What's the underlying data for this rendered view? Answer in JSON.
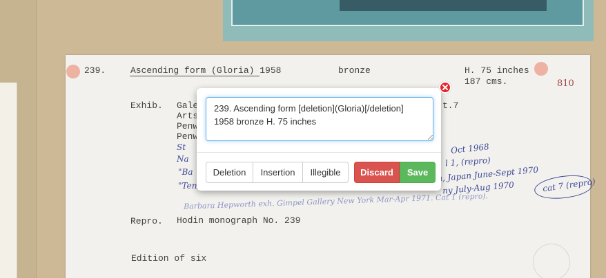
{
  "card": {
    "number": "239.",
    "title": "Ascending form (Gloria) 1958",
    "material": "bronze",
    "height_in": "H. 75 inches",
    "height_cm": "187 cms.",
    "catalogue_number": "810",
    "exhib_label": "Exhib.",
    "exhib_lines": [
      "Gale",
      "Arts",
      "Penw",
      "Penw"
    ],
    "exhib_fragment": "t.7",
    "handwritten": [
      "St",
      "Na",
      "\"Ba",
      "\"Ten",
      "Oct 1968",
      "l 1, (repro)",
      "n, Japan June-Sept 1970",
      "ny July-Aug 1970",
      "cat 7 (repro)",
      "Barbara Hepworth exh. Gimpel Gallery New York Mar-Apr 1971. Cat 1 (repro)."
    ],
    "repro_label": "Repro.",
    "repro_value": "Hodin monograph No. 239",
    "edition": "Edition of six"
  },
  "editor": {
    "text": "239. Ascending form [deletion](Gloria)[/deletion] 1958 bronze H. 75 inches",
    "buttons": {
      "deletion": "Deletion",
      "insertion": "Insertion",
      "illegible": "Illegible",
      "discard": "Discard",
      "save": "Save"
    }
  },
  "colors": {
    "discard": "#d9534f",
    "save": "#5cb85c",
    "close": "#e8242b",
    "focus": "#66afe9"
  }
}
